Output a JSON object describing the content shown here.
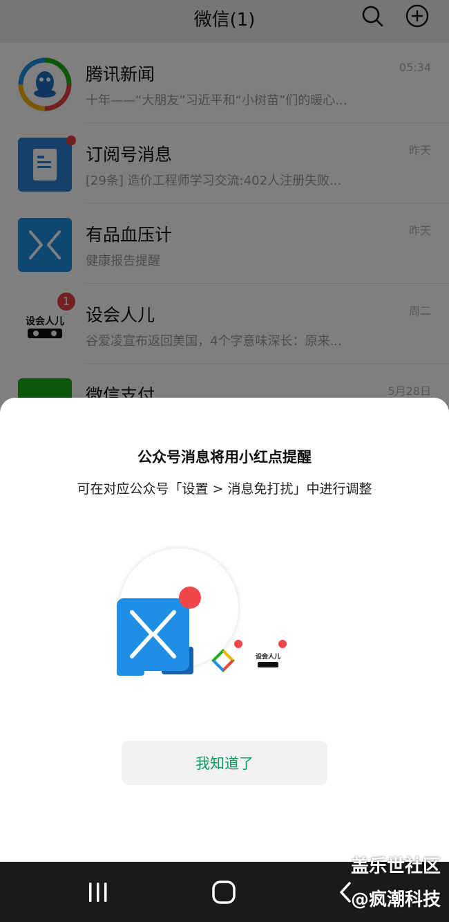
{
  "header": {
    "title": "微信(1)",
    "search_icon": "search-icon",
    "add_icon": "plus-circle-icon"
  },
  "chats": [
    {
      "name": "腾讯新闻",
      "preview": "十年——“大朋友”习近平和“小树苗”们的暖心...",
      "time": "05:34",
      "avatar_icon": "tencent-news-avatar"
    },
    {
      "name": "订阅号消息",
      "preview": "[29条] 造价工程师学习交流:402人注册失败...",
      "time": "昨天",
      "avatar_icon": "document-avatar",
      "unread_dot": true
    },
    {
      "name": "有品血压计",
      "preview": "健康报告提醒",
      "time": "昨天",
      "avatar_icon": "youpin-x-avatar"
    },
    {
      "name": "设会人儿",
      "preview": "谷爱凌宣布返回美国，4个字意味深长：原来...",
      "time": "周二",
      "avatar_icon": "shehuiren-avatar",
      "unread_count": "1"
    },
    {
      "name": "微信支付",
      "preview": "",
      "time": "5月28日",
      "avatar_icon": "wechat-pay-avatar"
    }
  ],
  "dialog": {
    "title": "公众号消息将用小红点提醒",
    "subtitle": "可在对应公众号「设置 > 消息免打扰」中进行调整",
    "illustration_logo_text": "设会人儿",
    "ok_label": "我知道了"
  },
  "navbar": {
    "recent_icon": "recent-apps-icon",
    "home_icon": "home-icon",
    "back_icon": "back-icon"
  },
  "watermark": {
    "line1": "盖乐世社区",
    "line2": "@疯潮科技"
  },
  "colors": {
    "accent_green": "#07a05f",
    "badge_red": "#e64340",
    "youpin_blue": "#1f8fe6"
  }
}
